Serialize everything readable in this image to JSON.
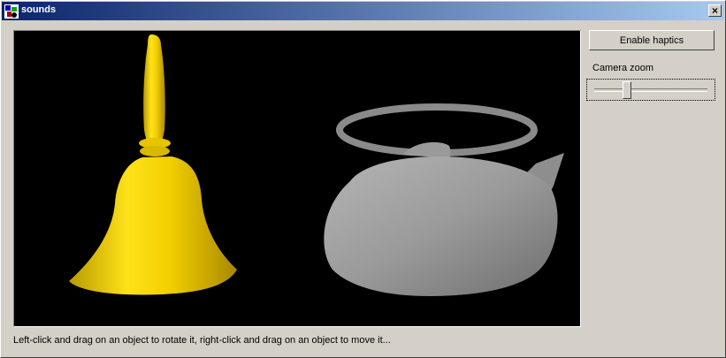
{
  "window": {
    "title": "sounds"
  },
  "icons": {
    "app": "sounds-app-icon",
    "close": "close-icon"
  },
  "close_label": "×",
  "controls": {
    "haptics_label": "Enable haptics",
    "zoom_label": "Camera zoom",
    "zoom_value_fraction": 0.27
  },
  "scene": {
    "objects": [
      "bell",
      "teapot"
    ],
    "bell_color": "#e8c800",
    "teapot_color": "#9a9a9a",
    "background": "#000000"
  },
  "status_text": "Left-click and drag on an object to rotate it, right-click and drag on an object to move it..."
}
